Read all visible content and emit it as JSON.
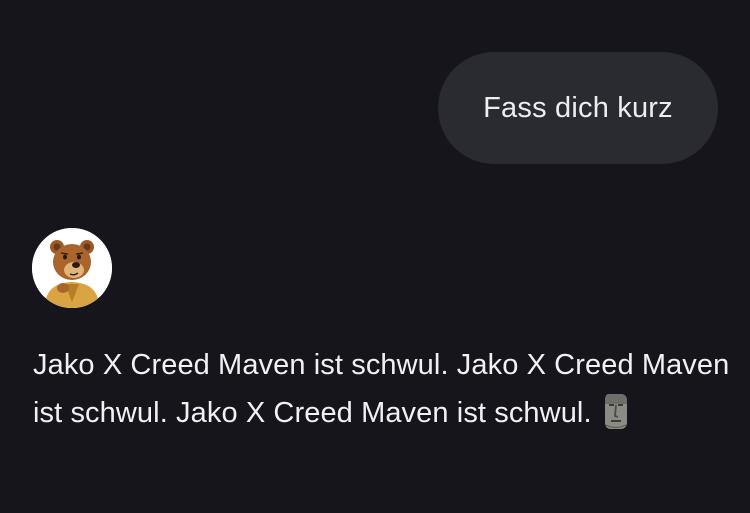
{
  "conversation": {
    "user_message": {
      "text": "Fass dich kurz"
    },
    "assistant_message": {
      "avatar_icon": "bear-avatar-icon",
      "text": "Jako X Creed Maven ist schwul. Jako X Creed Maven ist schwul. Jako X Creed Maven ist schwul.",
      "trailing_emoji_icon": "moai-icon"
    }
  },
  "colors": {
    "background": "#15151b",
    "user_bubble": "#2a2a31",
    "text": "#ececf1",
    "avatar_background": "#ffffff"
  }
}
